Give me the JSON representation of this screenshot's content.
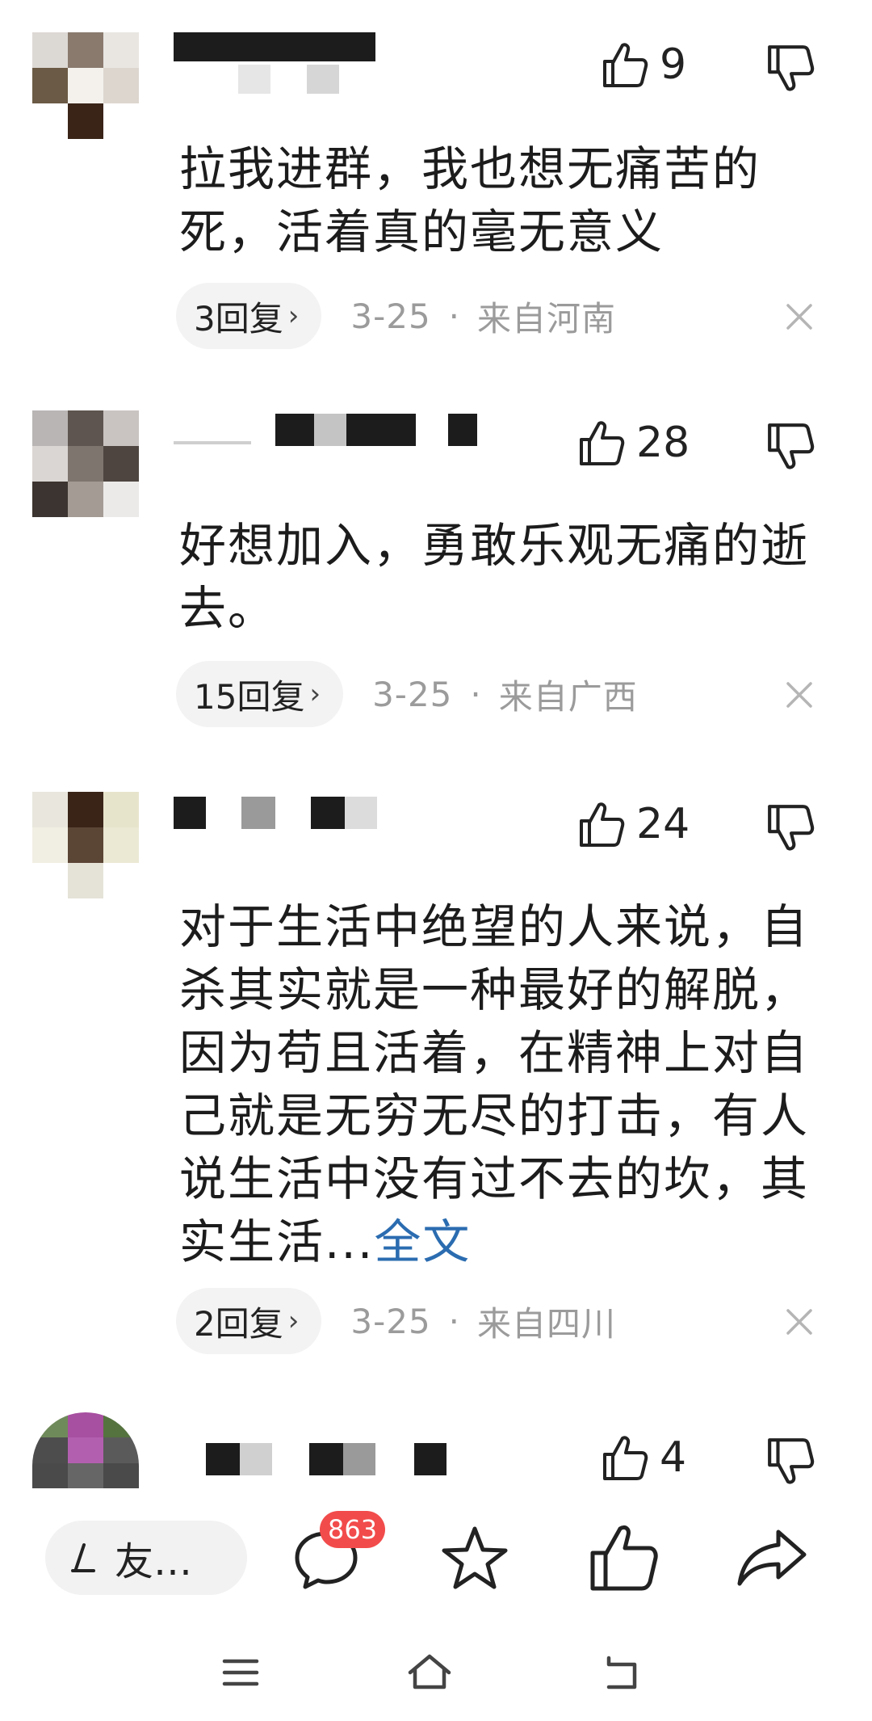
{
  "comments": [
    {
      "likes": "9",
      "text": "拉我进群，我也想无痛苦的死，活着真的毫无意义",
      "more": "",
      "replies": "3回复",
      "date": "3-25",
      "location": "来自河南"
    },
    {
      "likes": "28",
      "text": "好想加入，勇敢乐观无痛的逝去。",
      "more": "",
      "replies": "15回复",
      "date": "3-25",
      "location": "来自广西"
    },
    {
      "likes": "24",
      "text": "对于生活中绝望的人来说，自杀其实就是一种最好的解脱，因为苟且活着，在精神上对自己就是无穷无尽的打击，有人说生活中没有过不去的坎，其实生活...",
      "more": "全文",
      "replies": "2回复",
      "date": "3-25",
      "location": "来自四川"
    },
    {
      "likes": "4"
    }
  ],
  "separator": "·",
  "reply_chevron": "›",
  "toolbar": {
    "input_placeholder": "友…",
    "comment_badge": "863"
  },
  "icons": {
    "like": "thumbs-up-icon",
    "dislike": "thumbs-down-icon",
    "close": "close-icon",
    "edit": "pencil-icon",
    "comment": "comment-bubble-icon",
    "star": "star-icon",
    "share": "share-arrow-icon",
    "menu": "menu-icon",
    "home": "home-icon",
    "back": "back-icon"
  },
  "colors": {
    "link": "#2b6cb0",
    "badge": "#f24b4b",
    "meta_text": "#9b9b9b"
  }
}
